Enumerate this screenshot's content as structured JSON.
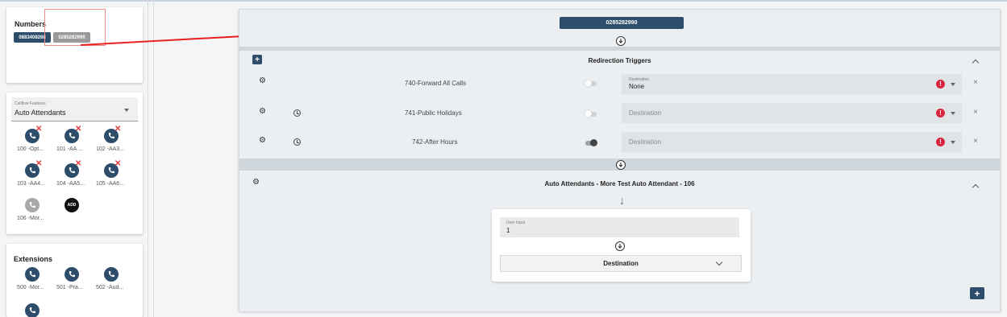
{
  "numbers_card": {
    "title": "Numbers",
    "chips": [
      "0883408268",
      "0285282990"
    ]
  },
  "callflow_card": {
    "select_label": "Callflow Features",
    "select_value": "Auto Attendants",
    "items": [
      "100 -Opt...",
      "101 -AA ...",
      "102 -AA3...",
      "103 -AA4...",
      "104 -AA5...",
      "105 -AA6...",
      "106 -Mor..."
    ],
    "add_label": "ADD"
  },
  "extensions_card": {
    "title": "Extensions",
    "items": [
      "500 -Mor...",
      "501 -Pra...",
      "502 -Aud..."
    ]
  },
  "main": {
    "number_button": "0285282990",
    "triggers_title": "Redirection Triggers",
    "triggers": [
      {
        "name": "740-Forward All Calls",
        "toggle_on": false,
        "dest_small": "Destination",
        "dest_value": "None"
      },
      {
        "name": "741-Public Holidays",
        "toggle_on": false,
        "dest_label": "Destination"
      },
      {
        "name": "742-After Hours",
        "toggle_on": true,
        "dest_label": "Destination"
      }
    ],
    "error_glyph": "!",
    "close_glyph": "×",
    "attendant_title": "Auto Attendants - More Test Auto Attendant - 106",
    "user_input_label": "User Input",
    "user_input_value": "1",
    "destination_label": "Destination",
    "plus_glyph": "+",
    "down_arrow": "↓"
  },
  "colors": {
    "navy": "#2d4d6b",
    "grey_chip": "#9a9a9a",
    "error": "#d7263d",
    "annotation_red": "#e8201f"
  },
  "icons": [
    "phone-icon",
    "settings-icon",
    "clock-icon",
    "error-icon",
    "chevron-up-icon",
    "chevron-down-icon",
    "close-icon",
    "add-icon",
    "arrow-down-circle-icon"
  ]
}
